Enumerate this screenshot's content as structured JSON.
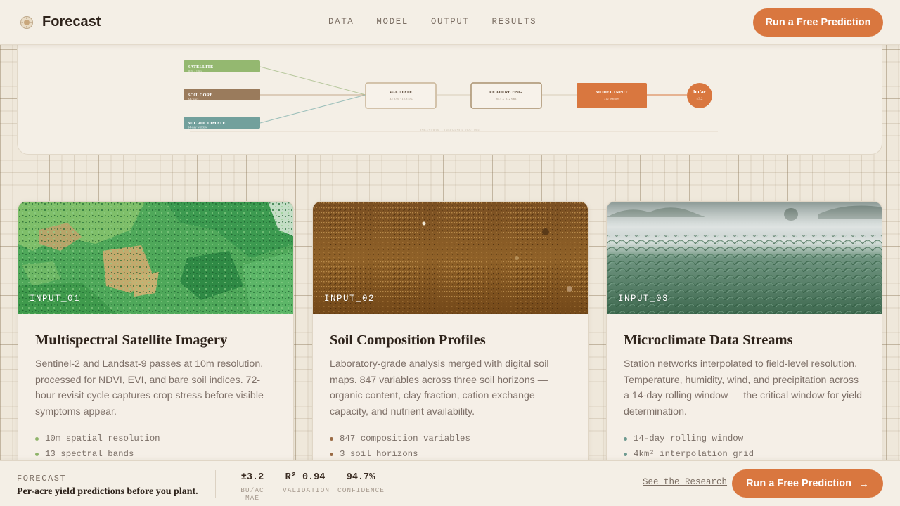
{
  "header": {
    "brand": "Forecast",
    "logo_icon": "sun-icon",
    "nav": [
      "DATA",
      "MODEL",
      "OUTPUT",
      "RESULTS"
    ],
    "cta_label": "Run a Free Prediction"
  },
  "pipeline": {
    "inputs": [
      {
        "label": "SATELLITE",
        "sub": "10m · 10m",
        "color": "#94b870"
      },
      {
        "label": "SOIL CORE",
        "sub": "847 vars",
        "color": "#9a7b5c"
      },
      {
        "label": "MICROCLIMATE",
        "sub": "14-day window",
        "color": "#72a09c"
      }
    ],
    "stages": [
      {
        "label": "VALIDATE",
        "sub": "R2 0.94 · 12.8 k%"
      },
      {
        "label": "FEATURE ENG.",
        "sub": "847 → 312 vars"
      },
      {
        "label": "MODEL INPUT",
        "sub": "312 features"
      }
    ],
    "output": {
      "label": "bu/ac",
      "sub": "±3.2"
    },
    "caption": "INGESTION → INFERENCE PIPELINE"
  },
  "cards": [
    {
      "tag": "INPUT_01",
      "title": "Multispectral Satellite Imagery",
      "description": "Sentinel-2 and Landsat-9 passes at 10m resolution, processed for NDVI, EVI, and bare soil indices. 72-hour revisit cycle captures crop stress before visible symptoms appear.",
      "bullets": [
        "10m spatial resolution",
        "13 spectral bands"
      ],
      "bullet_color": "#8fb46a",
      "image_icon": "satellite-imagery-photo"
    },
    {
      "tag": "INPUT_02",
      "title": "Soil Composition Profiles",
      "description": "Laboratory-grade analysis merged with digital soil maps. 847 variables across three soil horizons — organic content, clay fraction, cation exchange capacity, and nutrient availability.",
      "bullets": [
        "847 composition variables",
        "3 soil horizons"
      ],
      "bullet_color": "#9a6b45",
      "image_icon": "soil-photo"
    },
    {
      "tag": "INPUT_03",
      "title": "Microclimate Data Streams",
      "description": "Station networks interpolated to field-level resolution. Temperature, humidity, wind, and precipitation across a 14-day rolling window — the critical window for yield determination.",
      "bullets": [
        "14-day rolling window",
        "4km² interpolation grid"
      ],
      "bullet_color": "#6e9a90",
      "image_icon": "cornfield-photo"
    }
  ],
  "footer": {
    "brand": "FORECAST",
    "tagline": "Per-acre yield predictions before you plant.",
    "stats": [
      {
        "value": "±3.2",
        "label": "BU/AC MAE"
      },
      {
        "value": "R² 0.94",
        "label": "VALIDATION"
      },
      {
        "value": "94.7%",
        "label": "CONFIDENCE"
      }
    ],
    "research_link": "See the Research",
    "cta_label": "Run a Free Prediction",
    "cta_icon": "arrow-right-icon"
  },
  "colors": {
    "accent": "#d9773f",
    "background": "#efe8db",
    "panel": "#f4efe6"
  }
}
